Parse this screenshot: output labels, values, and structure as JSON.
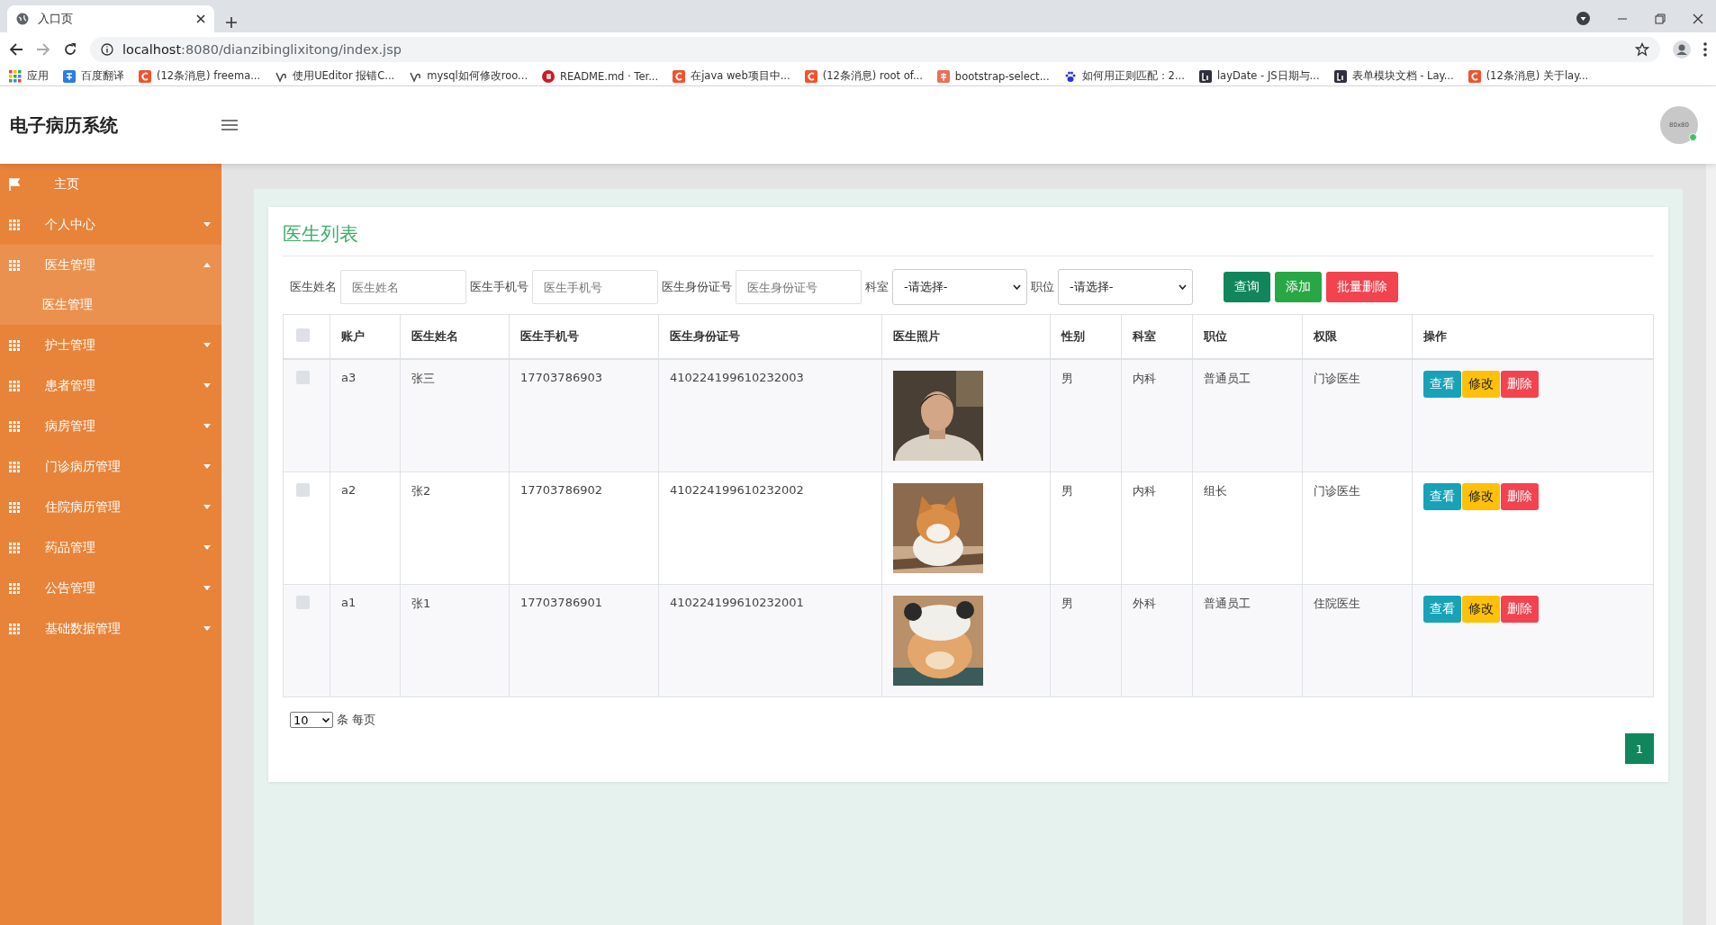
{
  "browser": {
    "tab_title": "入口页",
    "url_host": "localhost",
    "url_rest": ":8080/dianzibinglixitong/index.jsp",
    "bookmarks": [
      {
        "label": "应用",
        "kind": "apps"
      },
      {
        "label": "百度翻译",
        "kind": "translate"
      },
      {
        "label": "(12条消息) freema...",
        "kind": "csdn"
      },
      {
        "label": "使用UEditor 报错C...",
        "kind": "ueditor"
      },
      {
        "label": "mysql如何修改roo...",
        "kind": "ueditor"
      },
      {
        "label": "README.md · Ter...",
        "kind": "gitee"
      },
      {
        "label": "在java web项目中...",
        "kind": "csdn"
      },
      {
        "label": "(12条消息) root of...",
        "kind": "csdn"
      },
      {
        "label": "bootstrap-select...",
        "kind": "jianshu"
      },
      {
        "label": "如何用正则匹配：2...",
        "kind": "baidu"
      },
      {
        "label": "layDate - JS日期与...",
        "kind": "layui"
      },
      {
        "label": "表单模块文档 - Lay...",
        "kind": "layui"
      },
      {
        "label": "(12条消息) 关于lay...",
        "kind": "csdn"
      }
    ]
  },
  "app": {
    "title": "电子病历系统",
    "avatar_label": "80x80"
  },
  "sidebar": {
    "items": [
      {
        "label": "主页",
        "kind": "home"
      },
      {
        "label": "个人中心",
        "kind": "menu",
        "expanded": false
      },
      {
        "label": "医生管理",
        "kind": "menu",
        "expanded": true,
        "children": [
          {
            "label": "医生管理"
          }
        ]
      },
      {
        "label": "护士管理",
        "kind": "menu",
        "expanded": false
      },
      {
        "label": "患者管理",
        "kind": "menu",
        "expanded": false
      },
      {
        "label": "病房管理",
        "kind": "menu",
        "expanded": false
      },
      {
        "label": "门诊病历管理",
        "kind": "menu",
        "expanded": false
      },
      {
        "label": "住院病历管理",
        "kind": "menu",
        "expanded": false
      },
      {
        "label": "药品管理",
        "kind": "menu",
        "expanded": false
      },
      {
        "label": "公告管理",
        "kind": "menu",
        "expanded": false
      },
      {
        "label": "基础数据管理",
        "kind": "menu",
        "expanded": false
      }
    ]
  },
  "panel": {
    "title": "医生列表",
    "filters": [
      {
        "label": "医生姓名",
        "kind": "text",
        "placeholder": "医生姓名"
      },
      {
        "label": "医生手机号",
        "kind": "text",
        "placeholder": "医生手机号"
      },
      {
        "label": "医生身份证号",
        "kind": "text",
        "placeholder": "医生身份证号"
      },
      {
        "label": "科室",
        "kind": "select",
        "value": "-请选择-"
      },
      {
        "label": "职位",
        "kind": "select",
        "value": "-请选择-"
      }
    ],
    "buttons": [
      {
        "label": "查询",
        "kind": "query"
      },
      {
        "label": "添加",
        "kind": "add"
      },
      {
        "label": "批量删除",
        "kind": "delete"
      }
    ],
    "table": {
      "select_all": {
        "checked": false
      },
      "columns": [
        "账户",
        "医生姓名",
        "医生手机号",
        "医生身份证号",
        "医生照片",
        "性别",
        "科室",
        "职位",
        "权限",
        "操作"
      ],
      "rows": [
        {
          "checked": false,
          "account": "a3",
          "name": "张三",
          "phone": "17703786903",
          "id_number": "410224199610232003",
          "gender": "男",
          "department": "内科",
          "position": "普通员工",
          "role": "门诊医生",
          "actions": [
            {
              "label": "查看",
              "kind": "view"
            },
            {
              "label": "修改",
              "kind": "edit"
            },
            {
              "label": "删除",
              "kind": "delete"
            }
          ]
        },
        {
          "checked": false,
          "account": "a2",
          "name": "张2",
          "phone": "17703786902",
          "id_number": "410224199610232002",
          "gender": "男",
          "department": "内科",
          "position": "组长",
          "role": "门诊医生",
          "actions": [
            {
              "label": "查看",
              "kind": "view"
            },
            {
              "label": "修改",
              "kind": "edit"
            },
            {
              "label": "删除",
              "kind": "delete"
            }
          ]
        },
        {
          "checked": false,
          "account": "a1",
          "name": "张1",
          "phone": "17703786901",
          "id_number": "410224199610232001",
          "gender": "男",
          "department": "外科",
          "position": "普通员工",
          "role": "住院医生",
          "actions": [
            {
              "label": "查看",
              "kind": "view"
            },
            {
              "label": "修改",
              "kind": "edit"
            },
            {
              "label": "删除",
              "kind": "delete"
            }
          ]
        }
      ]
    },
    "page_size": "10",
    "page_size_suffix": "条 每页",
    "pages": [
      {
        "label": "1",
        "selected": true
      }
    ]
  }
}
